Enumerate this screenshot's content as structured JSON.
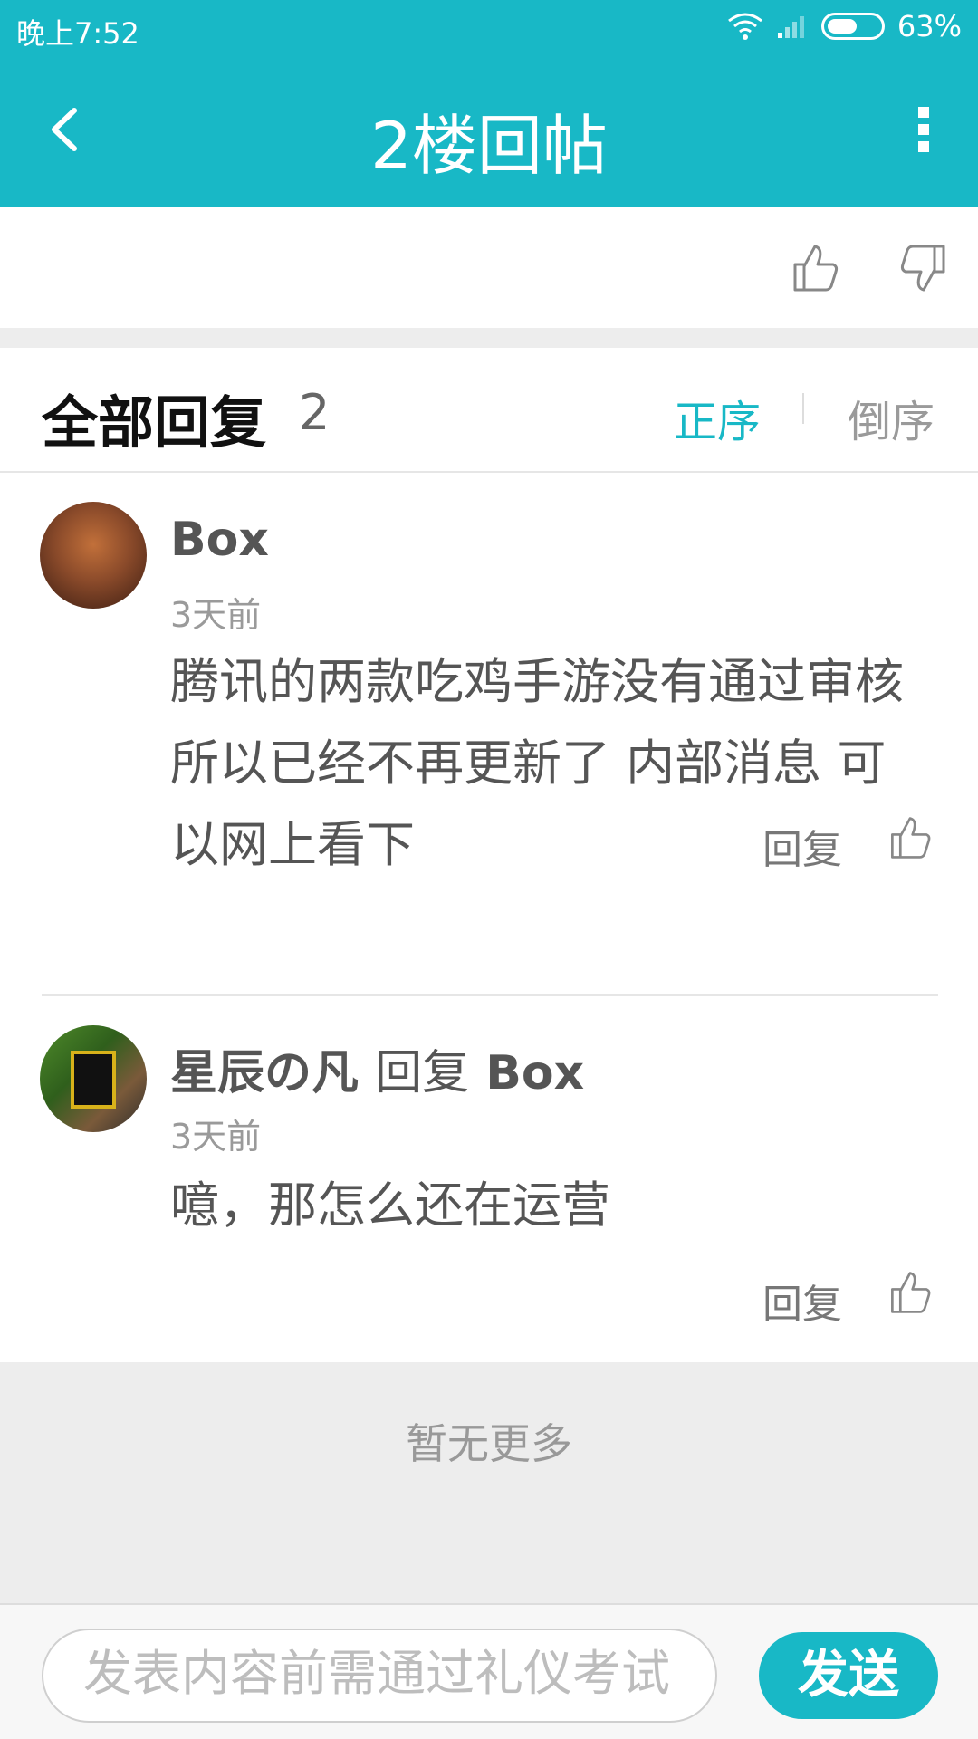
{
  "status": {
    "time": "晚上7:52",
    "battery": "63%",
    "battery_level": 0.63
  },
  "header": {
    "title": "2楼回帖",
    "back_icon": "chevron-left-icon",
    "more_icon": "more-vertical-icon"
  },
  "vote": {
    "up_icon": "thumbs-up-icon",
    "down_icon": "thumbs-down-icon"
  },
  "replies": {
    "title": "全部回复",
    "count": "2",
    "sort_asc": "正序",
    "sort_desc": "倒序",
    "items": [
      {
        "user": "Box",
        "reply_to_label": "",
        "reply_to_user": "",
        "time": "3天前",
        "content": "腾讯的两款吃鸡手游没有通过审核 所以已经不再更新了 内部消息 可以网上看下",
        "reply_label": "回复"
      },
      {
        "user": "星辰の凡",
        "reply_to_label": "回复",
        "reply_to_user": "Box",
        "time": "3天前",
        "content": "噫，那怎么还在运营",
        "reply_label": "回复"
      }
    ]
  },
  "footer": {
    "no_more": "暂无更多"
  },
  "composer": {
    "placeholder": "发表内容前需通过礼仪考试",
    "send_label": "发送"
  },
  "colors": {
    "accent": "#18b8c6"
  }
}
